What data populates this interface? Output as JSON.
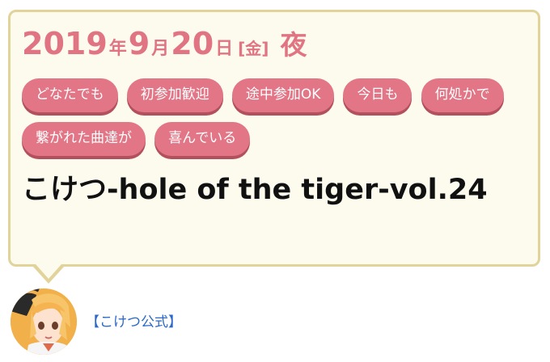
{
  "event": {
    "date": {
      "year": "2019",
      "year_unit": "年",
      "month": "9",
      "month_unit": "月",
      "day": "20",
      "day_unit": "日",
      "weekday": "[金]",
      "time_of_day": "夜"
    },
    "tags": [
      "どなたでも",
      "初参加歓迎",
      "途中参加OK",
      "今日も",
      "何処かで",
      "繋がれた曲達が",
      "喜んでいる"
    ],
    "title": "こけつ-hole of the tiger-vol.24"
  },
  "organizer": {
    "name": "【こけつ公式】",
    "avatar_icon": "organizer-avatar-icon"
  },
  "colors": {
    "accent": "#e07483",
    "tag_bg": "#e27586",
    "card_bg": "#fdfbee",
    "card_border": "#e2d39a",
    "link": "#2b68c9"
  }
}
